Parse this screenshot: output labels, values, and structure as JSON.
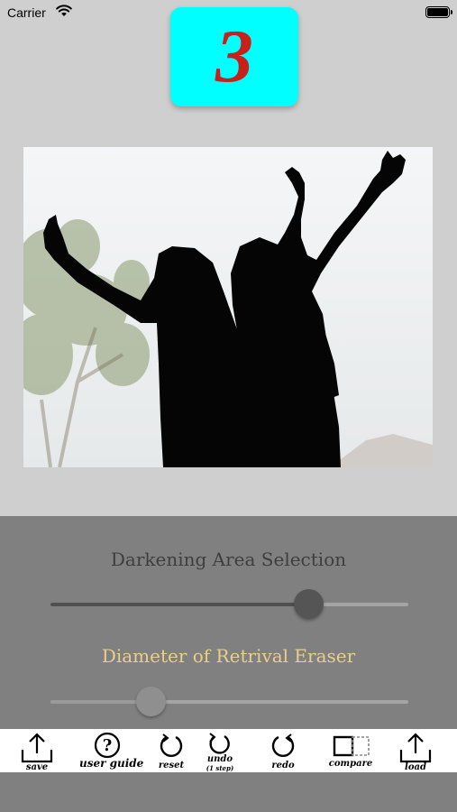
{
  "status_bar": {
    "carrier": "Carrier"
  },
  "step": {
    "number": "3",
    "badge_color": "#00ffff",
    "number_color": "#c8201b"
  },
  "controls": {
    "darkening_title": "Darkening Area Selection",
    "darkening_value": 0.72,
    "eraser_title": "Diameter of Retrival Eraser",
    "eraser_value": 0.28
  },
  "toolbar": {
    "items": [
      {
        "label": "save",
        "icon": "share-icon"
      },
      {
        "label": "user guide",
        "icon": "question-icon"
      },
      {
        "label": "reset",
        "icon": "reset-icon"
      },
      {
        "label": "undo",
        "sub": "(1 step)",
        "icon": "undo-icon"
      },
      {
        "label": "redo",
        "icon": "redo-icon"
      },
      {
        "label": "compare",
        "icon": "compare-icon"
      },
      {
        "label": "load",
        "icon": "upload-icon"
      }
    ]
  }
}
